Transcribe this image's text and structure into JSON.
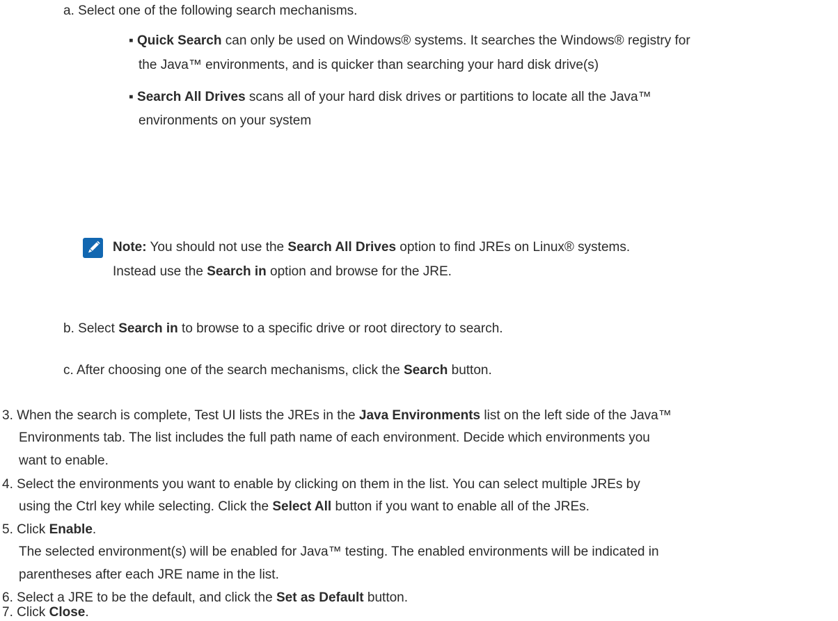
{
  "substeps": {
    "a": {
      "marker": "a.",
      "text": "Select one of the following search mechanisms.",
      "bullets": [
        {
          "bold": "Quick Search",
          "rest": " can only be used on Windows® systems. It searches the Windows® registry for",
          "cont": "the Java™ environments, and is quicker than searching your hard disk drive(s)"
        },
        {
          "bold": "Search All Drives",
          "rest": " scans all of your hard disk drives or partitions to locate all the Java™",
          "cont": "environments on your system"
        }
      ],
      "note": {
        "icon": "pencil-icon",
        "label": "Note:",
        "l1a": " You should not use the ",
        "l1b": "Search All Drives",
        "l1c": " option to find JREs on Linux® systems.",
        "l2a": "Instead use the ",
        "l2b": "Search in",
        "l2c": " option and browse for the JRE."
      }
    },
    "b": {
      "marker": "b.",
      "pre": "Select ",
      "bold": "Search in",
      "post": " to browse to a specific drive or root directory to search."
    },
    "c": {
      "marker": "c.",
      "pre": "After choosing one of the search mechanisms, click the ",
      "bold": "Search",
      "post": " button."
    }
  },
  "steps": [
    {
      "num": "3.",
      "l1a": "When the search is complete, Test UI lists the JREs in the ",
      "l1b": "Java Environments",
      "l1c": " list on the left side of the Java™",
      "l2": "Environments tab. The list includes the full path name of each environment. Decide which environments you",
      "l3": "want to enable."
    },
    {
      "num": "4.",
      "l1": "Select the environments you want to enable by clicking on them in the list. You can select multiple JREs by",
      "l2a": "using the Ctrl key while selecting. Click the ",
      "l2b": "Select All",
      "l2c": " button if you want to enable all of the JREs."
    },
    {
      "num": "5.",
      "l1a": "Click ",
      "l1b": "Enable",
      "l1c": ".",
      "l2": "The selected environment(s) will be enabled for Java™ testing. The enabled environments will be indicated in",
      "l3": "parentheses after each JRE name in the list."
    },
    {
      "num": "6.",
      "l1a": "Select a JRE to be the default, and click the ",
      "l1b": "Set as Default",
      "l1c": " button."
    },
    {
      "num": "7.",
      "l1a": "Click ",
      "l1b": "Close",
      "l1c": "."
    }
  ],
  "colors": {
    "text": "#2b2b2b",
    "note_icon_bg": "#1167b1"
  }
}
